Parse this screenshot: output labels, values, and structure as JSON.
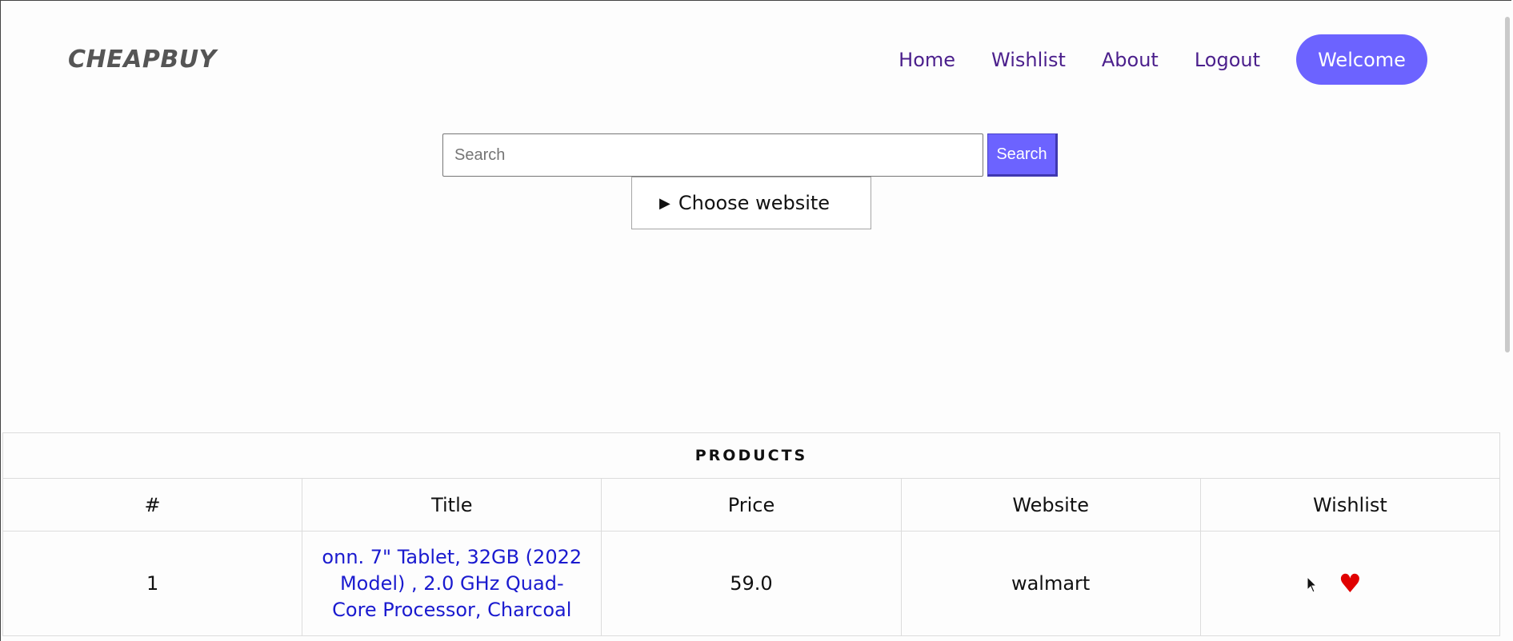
{
  "header": {
    "brand": "CHEAPBUY",
    "nav": [
      "Home",
      "Wishlist",
      "About",
      "Logout"
    ],
    "welcome_label": "Welcome"
  },
  "search": {
    "placeholder": "Search",
    "button_label": "Search",
    "choose_website": "Choose website"
  },
  "table": {
    "caption": "PRODUCTS",
    "columns": [
      "#",
      "Title",
      "Price",
      "Website",
      "Wishlist"
    ],
    "rows": [
      {
        "num": "1",
        "title": "onn. 7\" Tablet, 32GB (2022 Model) , 2.0 GHz Quad-Core Processor, Charcoal",
        "price": "59.0",
        "website": "walmart",
        "wishlist_icon": "heart-icon"
      }
    ]
  },
  "colors": {
    "accent": "#6c63ff",
    "nav_link": "#4b1f8c",
    "product_link": "#1a1acf",
    "heart": "#e00000"
  }
}
